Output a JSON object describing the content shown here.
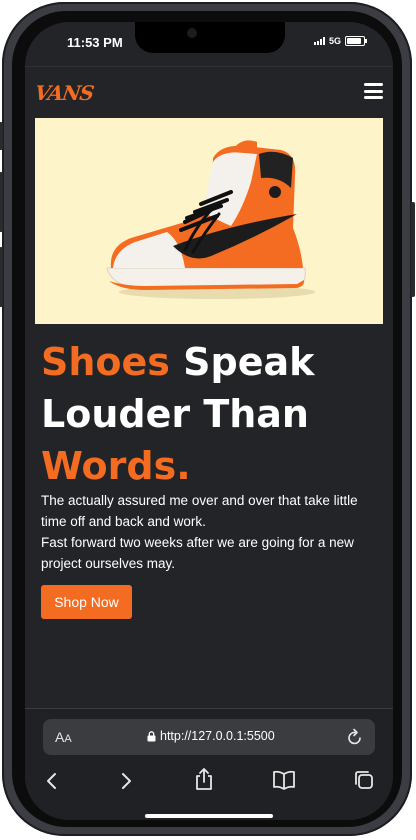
{
  "status": {
    "time": "11:53 PM",
    "network": "5G"
  },
  "header": {
    "logo": "VANS"
  },
  "hero": {
    "image_alt": "Orange and white high-top sneaker",
    "heading_part1": "Shoes",
    "heading_part2": " Speak Louder Than ",
    "heading_part3": "Words.",
    "desc_line1": "The actually assured me over and over that take little time off and back and work.",
    "desc_line2": "Fast forward two weeks after we are going for a new project ourselves may.",
    "button_label": "Shop Now"
  },
  "browser": {
    "aa_label_big": "A",
    "aa_label_small": "A",
    "url": "http://127.0.0.1:5500"
  },
  "colors": {
    "accent": "#f36c21",
    "background": "#222428",
    "hero_bg": "#fdf5c9"
  }
}
